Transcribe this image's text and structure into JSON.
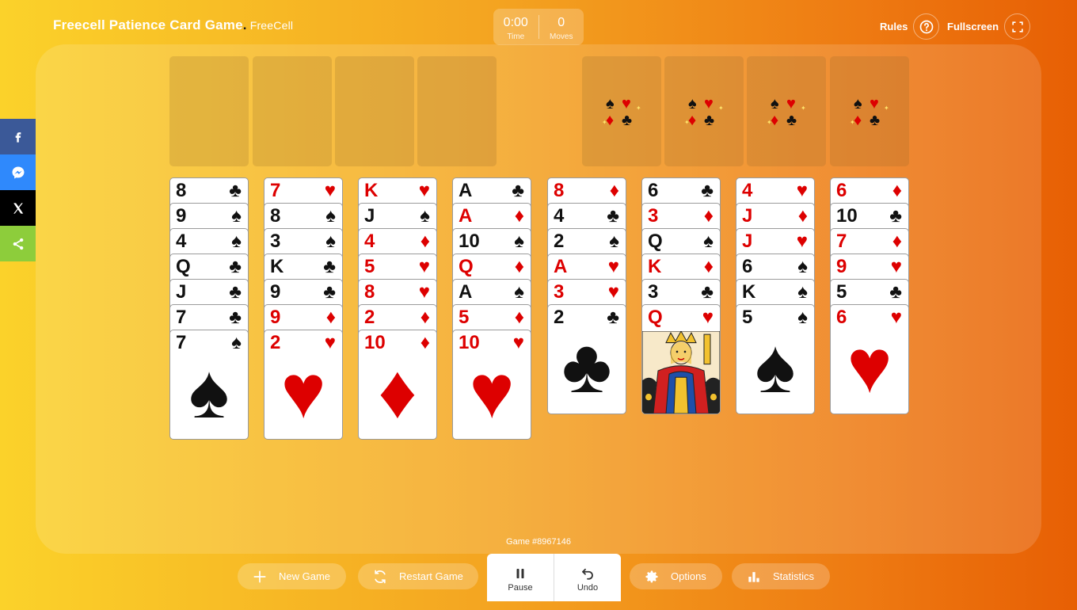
{
  "header": {
    "title": "Freecell Patience Card Game",
    "dot": ".",
    "subtitle": "FreeCell",
    "time_value": "0:00",
    "time_label": "Time",
    "moves_value": "0",
    "moves_label": "Moves",
    "rules_label": "Rules",
    "fullscreen_label": "Fullscreen"
  },
  "foundation_suits": [
    "♠",
    "♥",
    "♦",
    "♣"
  ],
  "columns": [
    [
      {
        "r": "8",
        "s": "♣",
        "c": "blk"
      },
      {
        "r": "9",
        "s": "♠",
        "c": "blk"
      },
      {
        "r": "4",
        "s": "♠",
        "c": "blk"
      },
      {
        "r": "Q",
        "s": "♣",
        "c": "blk"
      },
      {
        "r": "J",
        "s": "♣",
        "c": "blk"
      },
      {
        "r": "7",
        "s": "♣",
        "c": "blk"
      },
      {
        "r": "7",
        "s": "♠",
        "c": "blk"
      }
    ],
    [
      {
        "r": "7",
        "s": "♥",
        "c": "red"
      },
      {
        "r": "8",
        "s": "♠",
        "c": "blk"
      },
      {
        "r": "3",
        "s": "♠",
        "c": "blk"
      },
      {
        "r": "K",
        "s": "♣",
        "c": "blk"
      },
      {
        "r": "9",
        "s": "♣",
        "c": "blk"
      },
      {
        "r": "9",
        "s": "♦",
        "c": "red"
      },
      {
        "r": "2",
        "s": "♥",
        "c": "red"
      }
    ],
    [
      {
        "r": "K",
        "s": "♥",
        "c": "red"
      },
      {
        "r": "J",
        "s": "♠",
        "c": "blk"
      },
      {
        "r": "4",
        "s": "♦",
        "c": "red"
      },
      {
        "r": "5",
        "s": "♥",
        "c": "red"
      },
      {
        "r": "8",
        "s": "♥",
        "c": "red"
      },
      {
        "r": "2",
        "s": "♦",
        "c": "red"
      },
      {
        "r": "10",
        "s": "♦",
        "c": "red"
      }
    ],
    [
      {
        "r": "A",
        "s": "♣",
        "c": "blk"
      },
      {
        "r": "A",
        "s": "♦",
        "c": "red"
      },
      {
        "r": "10",
        "s": "♠",
        "c": "blk"
      },
      {
        "r": "Q",
        "s": "♦",
        "c": "red"
      },
      {
        "r": "A",
        "s": "♠",
        "c": "blk"
      },
      {
        "r": "5",
        "s": "♦",
        "c": "red"
      },
      {
        "r": "10",
        "s": "♥",
        "c": "red"
      }
    ],
    [
      {
        "r": "8",
        "s": "♦",
        "c": "red"
      },
      {
        "r": "4",
        "s": "♣",
        "c": "blk"
      },
      {
        "r": "2",
        "s": "♠",
        "c": "blk"
      },
      {
        "r": "A",
        "s": "♥",
        "c": "red"
      },
      {
        "r": "3",
        "s": "♥",
        "c": "red"
      },
      {
        "r": "2",
        "s": "♣",
        "c": "blk"
      }
    ],
    [
      {
        "r": "6",
        "s": "♣",
        "c": "blk"
      },
      {
        "r": "3",
        "s": "♦",
        "c": "red"
      },
      {
        "r": "Q",
        "s": "♠",
        "c": "blk"
      },
      {
        "r": "K",
        "s": "♦",
        "c": "red"
      },
      {
        "r": "3",
        "s": "♣",
        "c": "blk"
      },
      {
        "r": "Q",
        "s": "♥",
        "c": "red",
        "face": true
      }
    ],
    [
      {
        "r": "4",
        "s": "♥",
        "c": "red"
      },
      {
        "r": "J",
        "s": "♦",
        "c": "red"
      },
      {
        "r": "J",
        "s": "♥",
        "c": "red"
      },
      {
        "r": "6",
        "s": "♠",
        "c": "blk"
      },
      {
        "r": "K",
        "s": "♠",
        "c": "blk"
      },
      {
        "r": "5",
        "s": "♠",
        "c": "blk"
      }
    ],
    [
      {
        "r": "6",
        "s": "♦",
        "c": "red"
      },
      {
        "r": "10",
        "s": "♣",
        "c": "blk"
      },
      {
        "r": "7",
        "s": "♦",
        "c": "red"
      },
      {
        "r": "9",
        "s": "♥",
        "c": "red"
      },
      {
        "r": "5",
        "s": "♣",
        "c": "blk"
      },
      {
        "r": "6",
        "s": "♥",
        "c": "red"
      }
    ]
  ],
  "footer": {
    "game_number": "Game #8967146",
    "new_game": "New Game",
    "restart_game": "Restart Game",
    "pause": "Pause",
    "undo": "Undo",
    "options": "Options",
    "statistics": "Statistics"
  },
  "colors": {
    "red": "#dd0000",
    "black": "#111111",
    "facebook": "#3b5998",
    "messenger": "#2f89fc",
    "x": "#000000",
    "share": "#8dcd3b"
  }
}
